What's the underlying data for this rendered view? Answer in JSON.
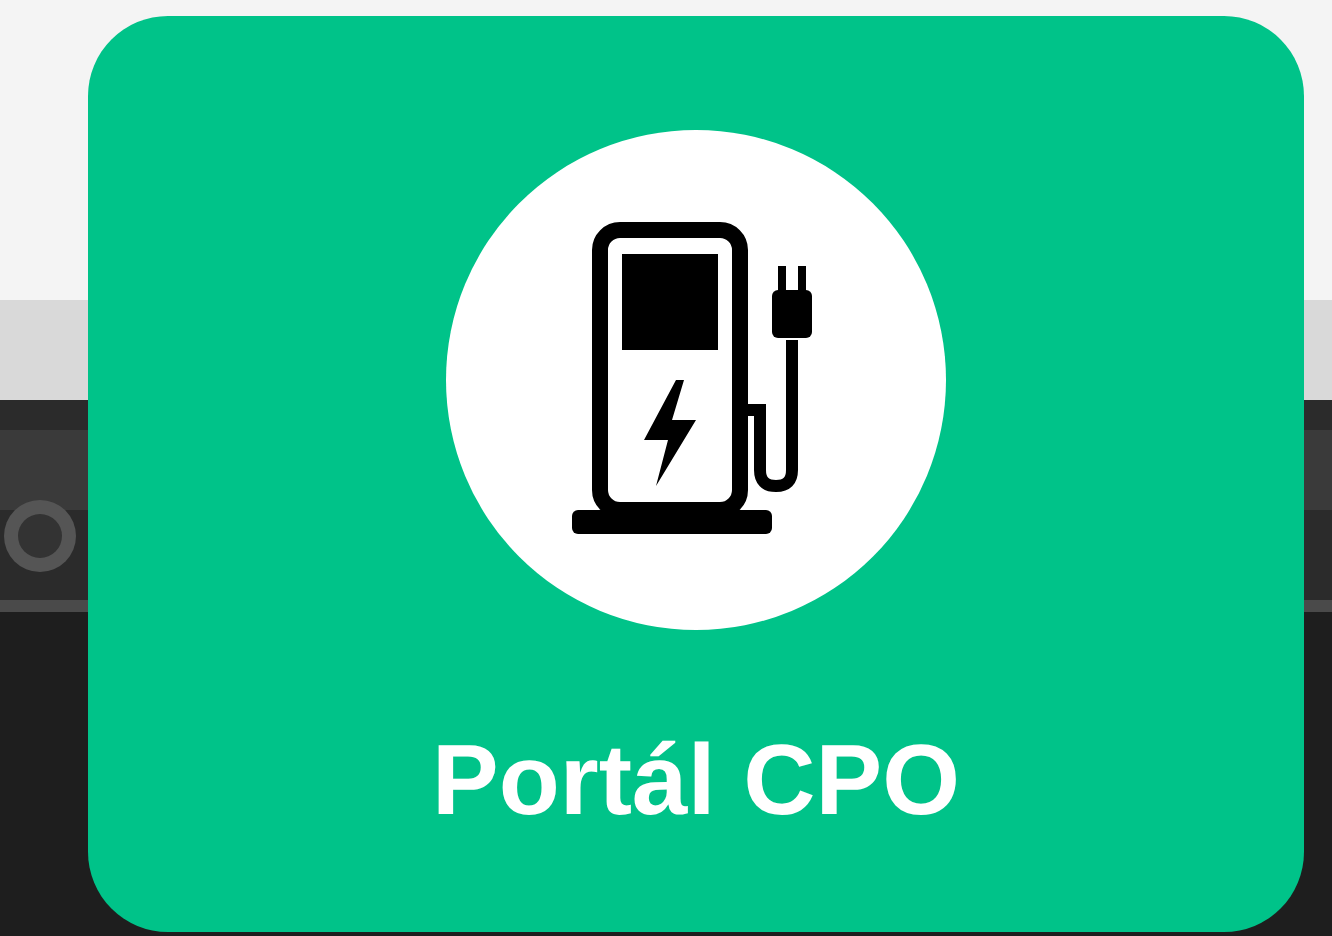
{
  "card": {
    "title": "Portál CPO"
  }
}
